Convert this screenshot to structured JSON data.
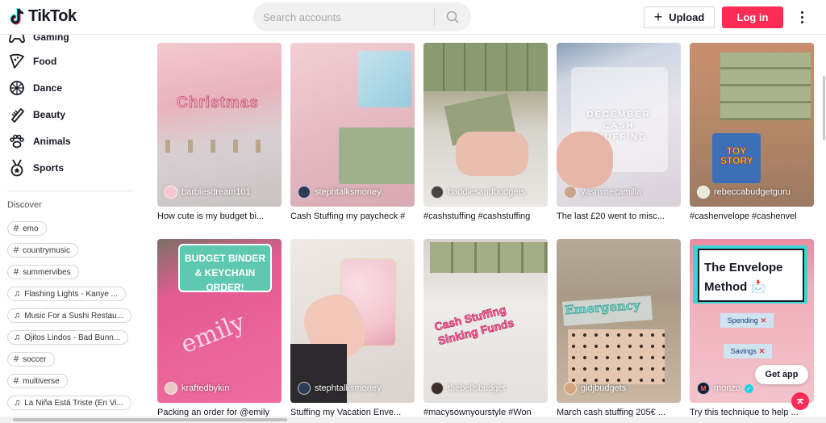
{
  "header": {
    "logo_text": "TikTok",
    "search_placeholder": "Search accounts",
    "upload_label": "Upload",
    "upload_plus": "+",
    "login_label": "Log in"
  },
  "sidebar": {
    "nav": [
      {
        "label": "Gaming",
        "icon": "gamepad-icon"
      },
      {
        "label": "Food",
        "icon": "pizza-icon"
      },
      {
        "label": "Dance",
        "icon": "dance-icon"
      },
      {
        "label": "Beauty",
        "icon": "comb-icon"
      },
      {
        "label": "Animals",
        "icon": "paw-icon"
      },
      {
        "label": "Sports",
        "icon": "medal-icon"
      }
    ],
    "discover_title": "Discover",
    "tags": [
      {
        "type": "hashtag",
        "label": "emo"
      },
      {
        "type": "hashtag",
        "label": "countrymusic"
      },
      {
        "type": "hashtag",
        "label": "summervibes"
      },
      {
        "type": "music",
        "label": "Flashing Lights - Kanye ..."
      },
      {
        "type": "music",
        "label": "Music For a Sushi Restau..."
      },
      {
        "type": "music",
        "label": "Ojitos Lindos - Bad Bunn..."
      },
      {
        "type": "hashtag",
        "label": "soccer"
      },
      {
        "type": "hashtag",
        "label": "multiverse"
      },
      {
        "type": "music",
        "label": "La Niña Está Triste (En Vi..."
      }
    ]
  },
  "videos": [
    {
      "author": "barbiesdream101",
      "caption": "How cute is my budget bi...",
      "overlay": "Christmas"
    },
    {
      "author": "stephtalksmoney",
      "caption": "Cash Stuffing my paycheck #",
      "overlay": ""
    },
    {
      "author": "baddiesandbudgets",
      "caption": "#cashstuffing #cashstuffing",
      "overlay": ""
    },
    {
      "author": "yasminecamilla",
      "caption": "The last £20 went to misc...",
      "overlay": "DECEMBER CASH STUFFING"
    },
    {
      "author": "rebeccabudgetguru",
      "caption": "#cashenvelope #cashenvel",
      "overlay": "TOY STORY"
    },
    {
      "author": "kraftedbykin",
      "caption": "Packing an order for @emily",
      "overlay": "BUDGET BINDER & KEYCHAIN ORDER!"
    },
    {
      "author": "stephtalksmoney",
      "caption": "Stuffing my Vacation Enve...",
      "overlay": ""
    },
    {
      "author": "thebellsbudget",
      "caption": "#macysownyourstyle #Won",
      "overlay": "Cash Stuffing Sinking Funds"
    },
    {
      "author": "gidjbudgets",
      "caption": "March cash stuffing 205€ ...",
      "overlay": "Emergency"
    },
    {
      "author": "monzo",
      "caption": "Try this technique to help ...",
      "overlay": "The Envelope Method 📩",
      "spending": "Spending",
      "savings": "Savings"
    }
  ],
  "get_app_label": "Get app"
}
